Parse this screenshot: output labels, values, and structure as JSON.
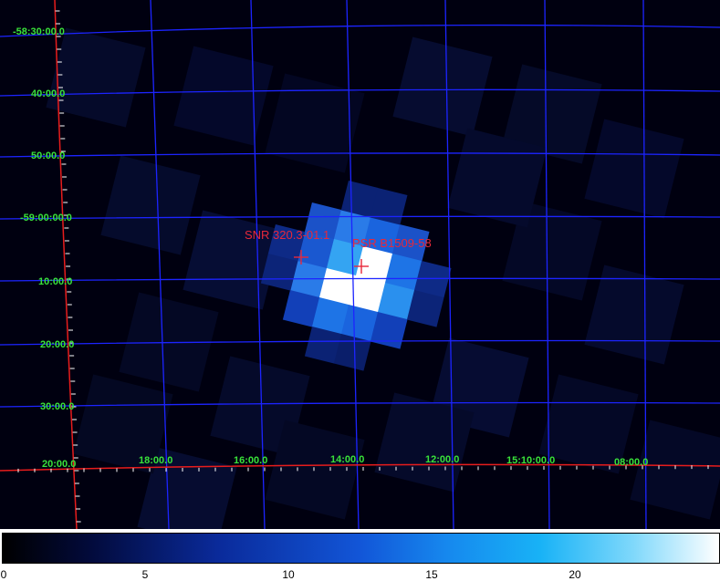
{
  "dec_labels": [
    {
      "text": "-58:30:00.0"
    },
    {
      "text": "40:00.0"
    },
    {
      "text": "50:00.0"
    },
    {
      "text": "-59:00:00.0"
    },
    {
      "text": "10:00.0"
    },
    {
      "text": "20:00.0"
    },
    {
      "text": "30:00.0"
    }
  ],
  "ra_labels": [
    {
      "text": "20:00.0"
    },
    {
      "text": "18:00.0"
    },
    {
      "text": "16:00.0"
    },
    {
      "text": "14:00.0"
    },
    {
      "text": "12:00.0"
    },
    {
      "text": "15:10:00.0"
    },
    {
      "text": "08:00.0"
    }
  ],
  "sources": [
    {
      "name": "SNR 320.3-01.1"
    },
    {
      "name": "PSR B1509-58"
    }
  ],
  "colorbar": {
    "ticks": [
      {
        "text": "0",
        "value": 0
      },
      {
        "text": "5",
        "value": 5
      },
      {
        "text": "10",
        "value": 10
      },
      {
        "text": "15",
        "value": 15
      },
      {
        "text": "20",
        "value": 20
      }
    ],
    "max": 25
  },
  "colors": {
    "grid": "#1c24ff",
    "axis": "#e81c1c",
    "label": "#39e23a",
    "marker": "#e8283a"
  }
}
